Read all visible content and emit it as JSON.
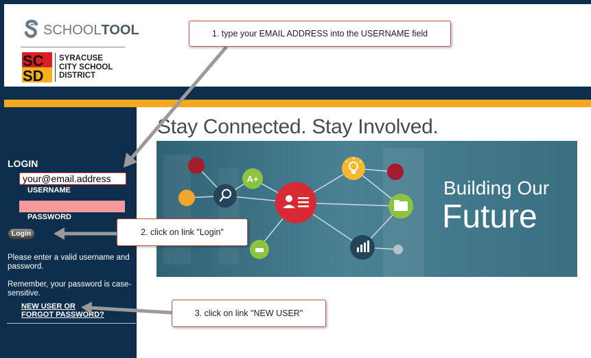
{
  "header": {
    "app_logo_text_light": "SCHOOL",
    "app_logo_text_bold": "TOOL",
    "district_name_lines": [
      "SYRACUSE",
      "CITY SCHOOL",
      "DISTRICT"
    ]
  },
  "sidebar": {
    "login_title": "LOGIN",
    "username_value": "your@email.address",
    "username_label": "USERNAME",
    "password_value": "",
    "password_label": "PASSWORD",
    "login_button": "Login",
    "help_text_1": "Please enter a valid username and password.",
    "help_text_2": "Remember, your password is case-sensitive.",
    "new_user_link_line1": "NEW USER OR",
    "new_user_link_line2": "FORGOT PASSWORD?"
  },
  "main": {
    "heading": "Stay Connected. Stay Involved.",
    "banner_line1": "Building Our",
    "banner_line2": "Future",
    "grade_badge": "A+"
  },
  "callouts": {
    "step1": "1. type your EMAIL ADDRESS  into the USERNAME field",
    "step2": "2. click on link  \"Login\"",
    "step3": "3. click on link  \"NEW USER\""
  },
  "colors": {
    "navy": "#0e2e4e",
    "gold": "#f3a81f",
    "teal_banner": "#3e7386",
    "callout_border": "#c0504d",
    "arrow_gray": "#9a9a9a"
  }
}
